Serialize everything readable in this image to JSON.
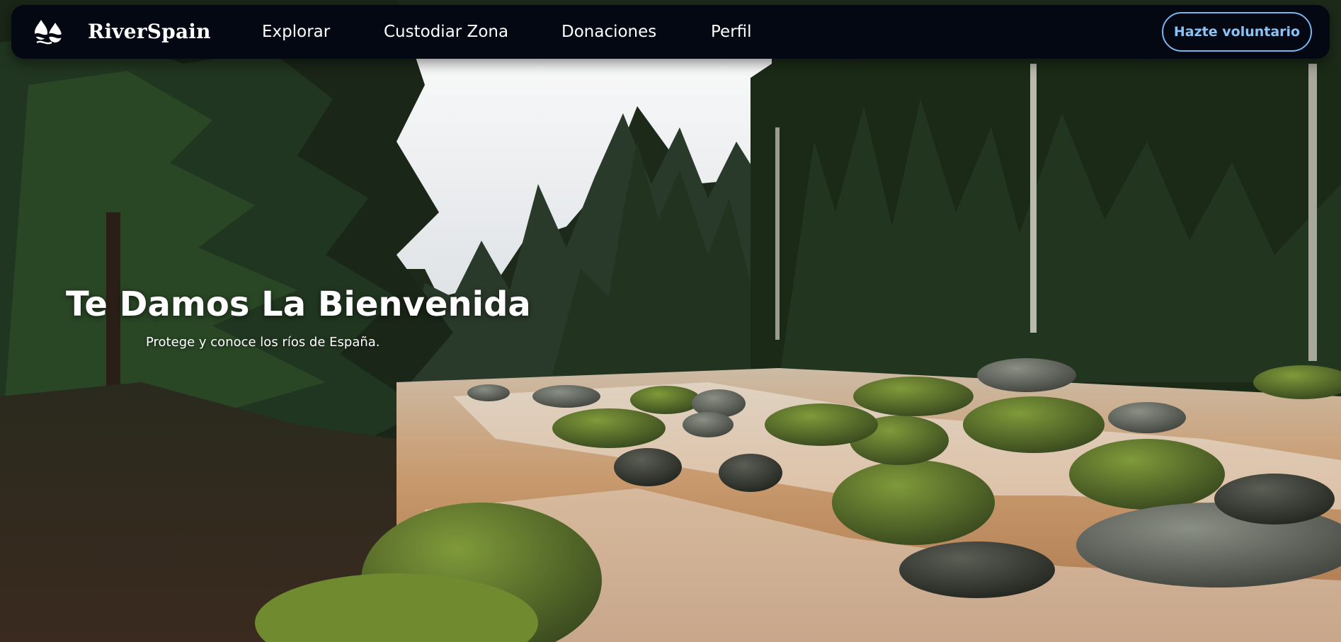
{
  "brand": {
    "name": "RiverSpain",
    "logo_icon": "river-drops-logo-icon"
  },
  "nav": {
    "items": [
      {
        "label": "Explorar"
      },
      {
        "label": "Custodiar Zona"
      },
      {
        "label": "Donaciones"
      },
      {
        "label": "Perfil"
      }
    ],
    "cta_label": "Hazte voluntario"
  },
  "hero": {
    "title": "Te Damos La Bienvenida",
    "subtitle": "Protege y conoce los ríos de España.",
    "background": "forest-river-rapids-photo"
  },
  "colors": {
    "navbar_bg": "#030812",
    "cta_border": "#79b6ee",
    "cta_text": "#8cc3f4",
    "text": "#ffffff"
  }
}
